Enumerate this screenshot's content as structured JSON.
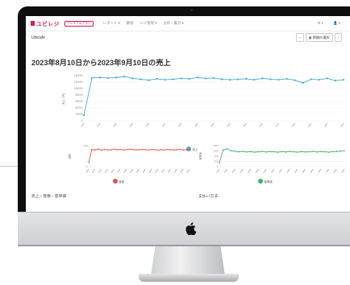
{
  "app": {
    "logo_text": "ユビレジ",
    "badge": "プレミアムプラン",
    "menu": [
      "レポート ▾",
      "顧客",
      "レジ管理 ▾",
      "分析・集計 ▾"
    ],
    "right": [
      "⚙ ▾",
      "👤 ▾"
    ]
  },
  "store_name": "Ubicafe",
  "date_nav": {
    "prev": "‹",
    "current": "▦ 期間の選択",
    "next": "›"
  },
  "report_title": "2023年8月10日から2023年9月10日の売上",
  "sections": {
    "left": "売上・客数・客単価",
    "right": "支払い方法"
  },
  "colors": {
    "blue": "#4aa9d6",
    "red": "#e5534b",
    "green": "#3fb36b",
    "accent": "#d81b60"
  },
  "chart_data": [
    {
      "type": "line",
      "series": [
        {
          "name": "売上",
          "color": "#4aa9d6",
          "values": [
            12,
            95,
            96,
            95,
            96,
            98,
            94,
            92,
            90,
            93,
            91,
            92,
            94,
            93,
            96,
            94,
            95,
            92,
            91,
            92,
            93,
            91,
            94,
            92,
            91,
            93,
            90,
            84,
            92,
            91,
            94,
            89,
            91
          ]
        }
      ],
      "ylim": [
        0,
        140000
      ],
      "yticks": [
        "140000",
        "120000",
        "100000",
        "80000",
        "60000",
        "40000",
        "20000",
        "0"
      ],
      "ylabel": "売上（円）"
    },
    {
      "type": "line",
      "series": [
        {
          "name": "客数",
          "color": "#e5534b",
          "values": [
            20,
            82,
            80,
            84,
            79,
            82,
            81,
            80,
            83,
            81,
            82,
            80,
            81,
            83,
            82,
            80,
            81,
            82,
            81,
            80,
            82,
            81,
            79,
            81,
            80,
            82,
            81,
            80,
            81,
            82,
            80,
            81,
            82
          ]
        }
      ],
      "yticks": [
        "500",
        "0"
      ],
      "ylabel": "客数"
    },
    {
      "type": "line",
      "series": [
        {
          "name": "客単価",
          "color": "#3fb36b",
          "values": [
            18,
            80,
            85,
            76,
            74,
            71,
            73,
            70,
            72,
            69,
            71,
            73,
            70,
            72,
            71,
            69,
            72,
            70,
            73,
            71,
            69,
            72,
            70,
            71,
            73,
            70,
            72,
            71,
            69,
            72,
            73,
            74,
            76
          ]
        }
      ],
      "yticks": [
        "800",
        "600",
        "400",
        "200",
        "0"
      ],
      "ylabel": "客単価"
    }
  ]
}
